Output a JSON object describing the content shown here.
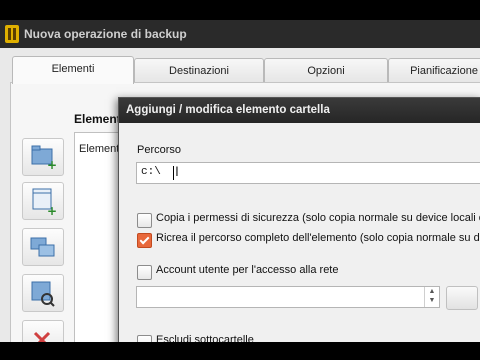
{
  "window": {
    "title": "Nuova operazione di backup"
  },
  "tabs": [
    {
      "label": "Elementi"
    },
    {
      "label": "Destinazioni"
    },
    {
      "label": "Opzioni"
    },
    {
      "label": "Pianificazione"
    }
  ],
  "main": {
    "elements_title": "Elementi",
    "list_header": "Elementi"
  },
  "dialog": {
    "title": "Aggiungi / modifica elemento cartella",
    "path_label": "Percorso",
    "path_value": "c:\\",
    "checkboxes": [
      {
        "label": "Copia i permessi di sicurezza (solo copia normale su device locali o",
        "checked": false
      },
      {
        "label": "Ricrea il percorso completo dell'elemento (solo copia normale su d",
        "checked": true
      },
      {
        "label": "Account utente per l'accesso alla rete",
        "checked": false
      },
      {
        "label": "Escludi sottocartelle",
        "checked": false
      }
    ],
    "account_value": ""
  },
  "colors": {
    "accent": "#e8683b",
    "titlebar": "#2a2a2a"
  }
}
